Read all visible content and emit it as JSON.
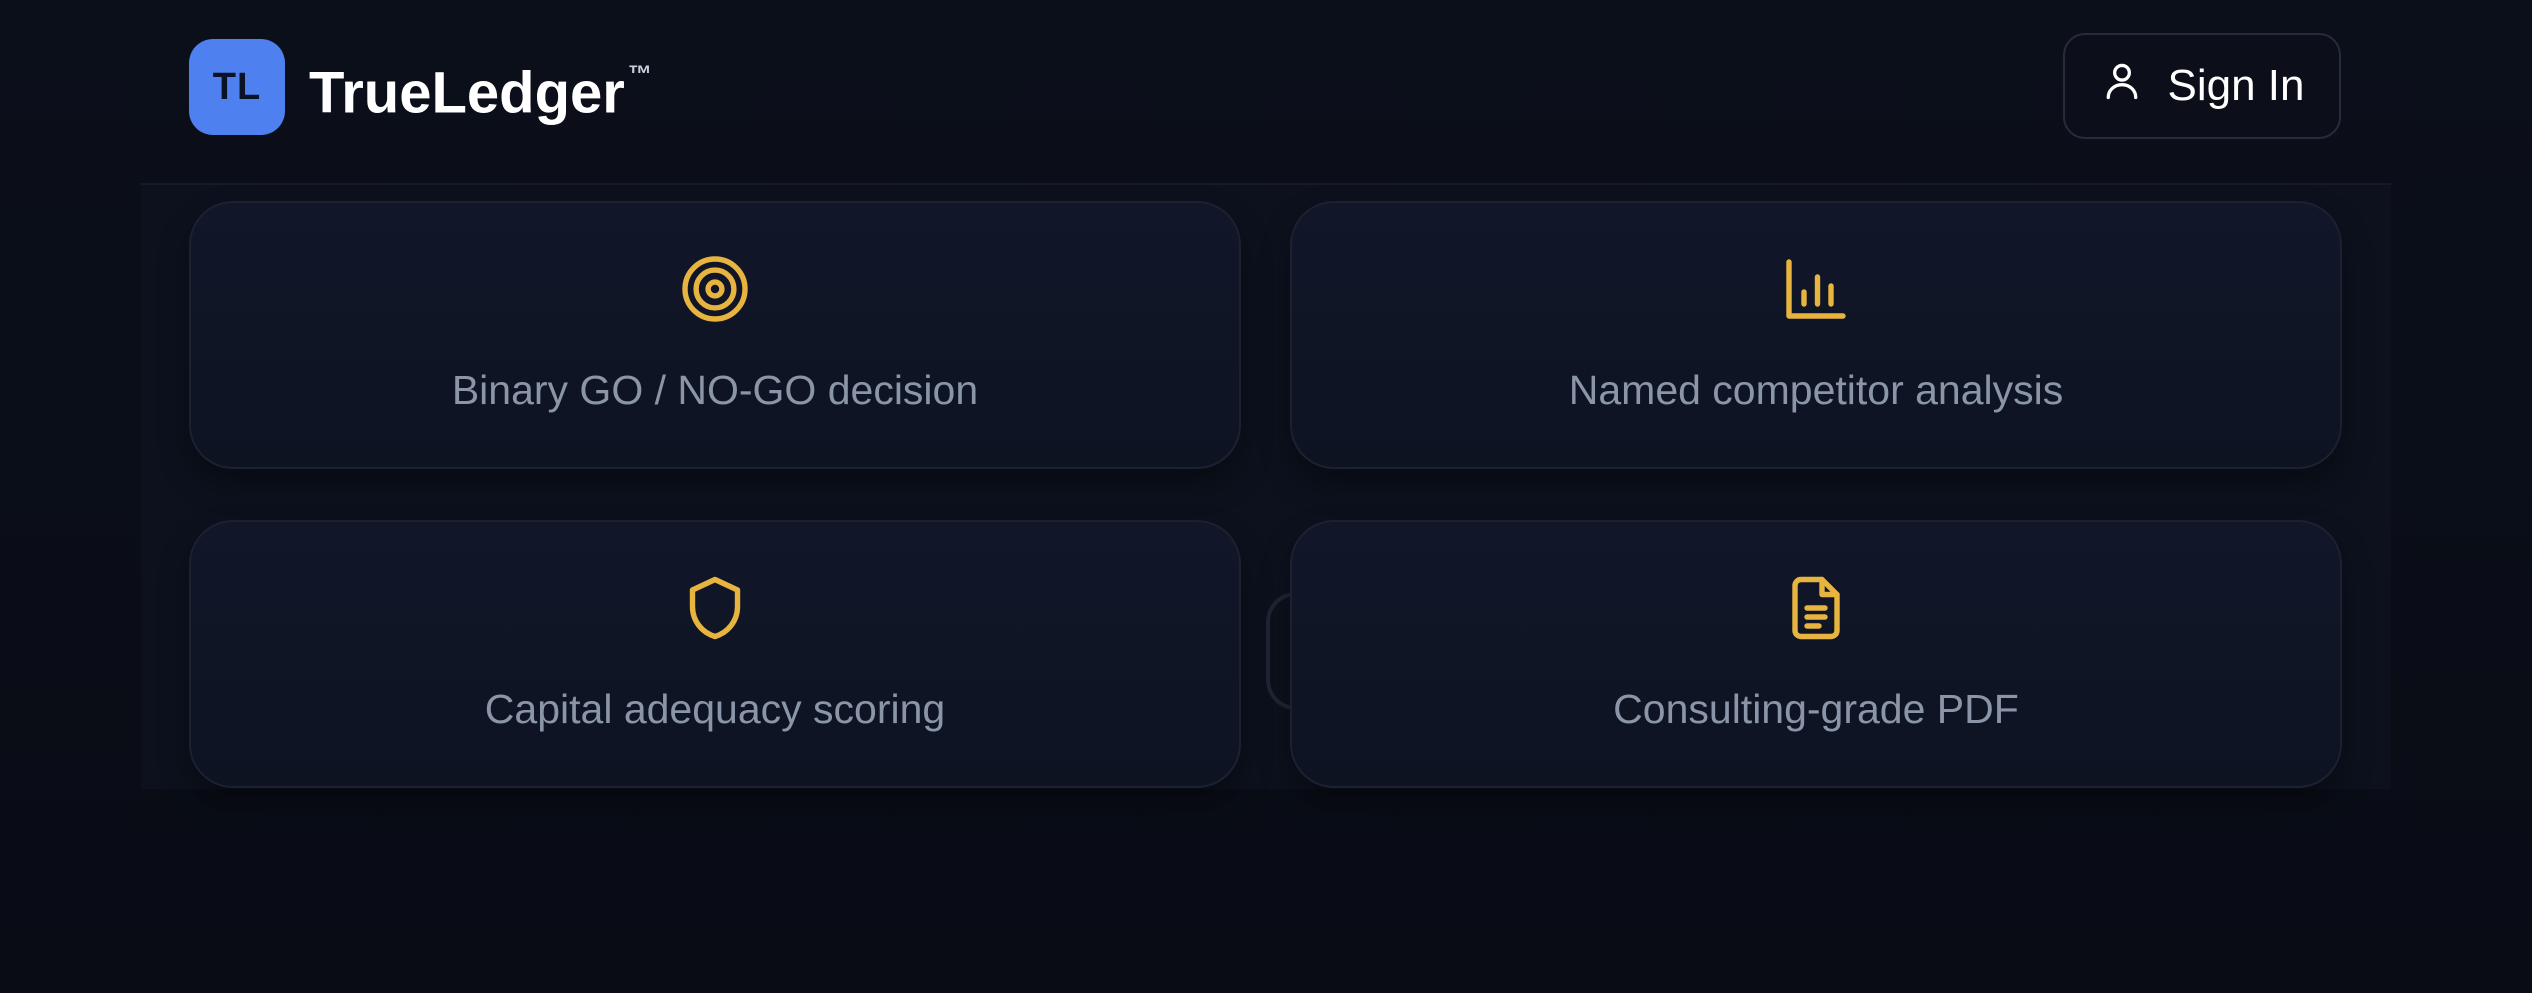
{
  "header": {
    "logo_initials": "TL",
    "brand_name": "TrueLedger",
    "trademark": "™",
    "signin_label": "Sign In",
    "signin_icon": "user-icon"
  },
  "features": [
    {
      "icon": "target-icon",
      "label": "Binary GO / NO-GO decision"
    },
    {
      "icon": "bar-chart-icon",
      "label": "Named competitor analysis"
    },
    {
      "icon": "shield-icon",
      "label": "Capital adequacy scoring"
    },
    {
      "icon": "document-icon",
      "label": "Consulting-grade PDF"
    }
  ],
  "colors": {
    "accent_blue": "#4f80f0",
    "icon_gold": "#e7b53f",
    "background": "#0a0d16",
    "card_label": "#8a95a8"
  }
}
